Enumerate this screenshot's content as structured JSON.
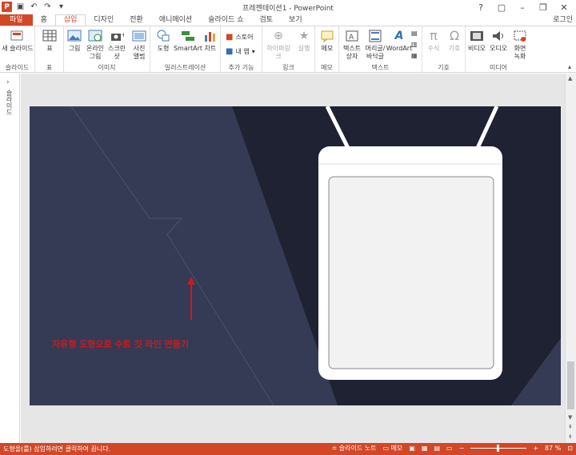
{
  "app": {
    "title": "프레젠테이션1 - PowerPoint",
    "login": "로그인",
    "logo_letter": "P"
  },
  "tabs": [
    {
      "label": "파일"
    },
    {
      "label": "홈"
    },
    {
      "label": "삽입"
    },
    {
      "label": "디자인"
    },
    {
      "label": "전환"
    },
    {
      "label": "애니메이션"
    },
    {
      "label": "슬라이드 쇼"
    },
    {
      "label": "검토"
    },
    {
      "label": "보기"
    }
  ],
  "ribbon": {
    "groups": {
      "slides": "슬라이드",
      "table": "표",
      "images": "이미지",
      "illustrations": "일러스트레이션",
      "addins": "추가 기능",
      "links": "링크",
      "comments": "메모",
      "text": "텍스트",
      "symbols": "기호",
      "media": "미디어"
    },
    "buttons": {
      "new_slide": "새 슬라이드",
      "table": "표",
      "pictures": "그림",
      "online_pictures": "온라인 그림",
      "screenshot": "스크린샷",
      "photo_album": "사진 앨범",
      "shapes": "도형",
      "smartart": "SmartArt",
      "chart": "차트",
      "store": "스토어",
      "my_apps": "내 앱",
      "hyperlink": "하이퍼링크",
      "action": "실행",
      "comment": "메모",
      "textbox": "텍스트 상자",
      "header_footer": "머리글/바닥글",
      "wordart": "WordArt",
      "equation": "수식",
      "symbol": "기호",
      "video": "비디오",
      "audio": "오디오",
      "screen_recording": "화면 녹화"
    }
  },
  "thumbnail_pane": {
    "label": "슬라이드"
  },
  "slide": {
    "annotation": "자유형 도형으로 수트  깃 라인 만들기",
    "colors": {
      "background": "#1f2233",
      "suit": "#363b55",
      "card": "#ffffff",
      "card_inner": "#f2f2f2",
      "arrow": "#cc1b1b"
    }
  },
  "status": {
    "message": "도형을(를) 삽입하려면 클릭하여 끕니다.",
    "notes": "슬라이드 노트",
    "comments": "메모",
    "zoom": "87 %"
  }
}
